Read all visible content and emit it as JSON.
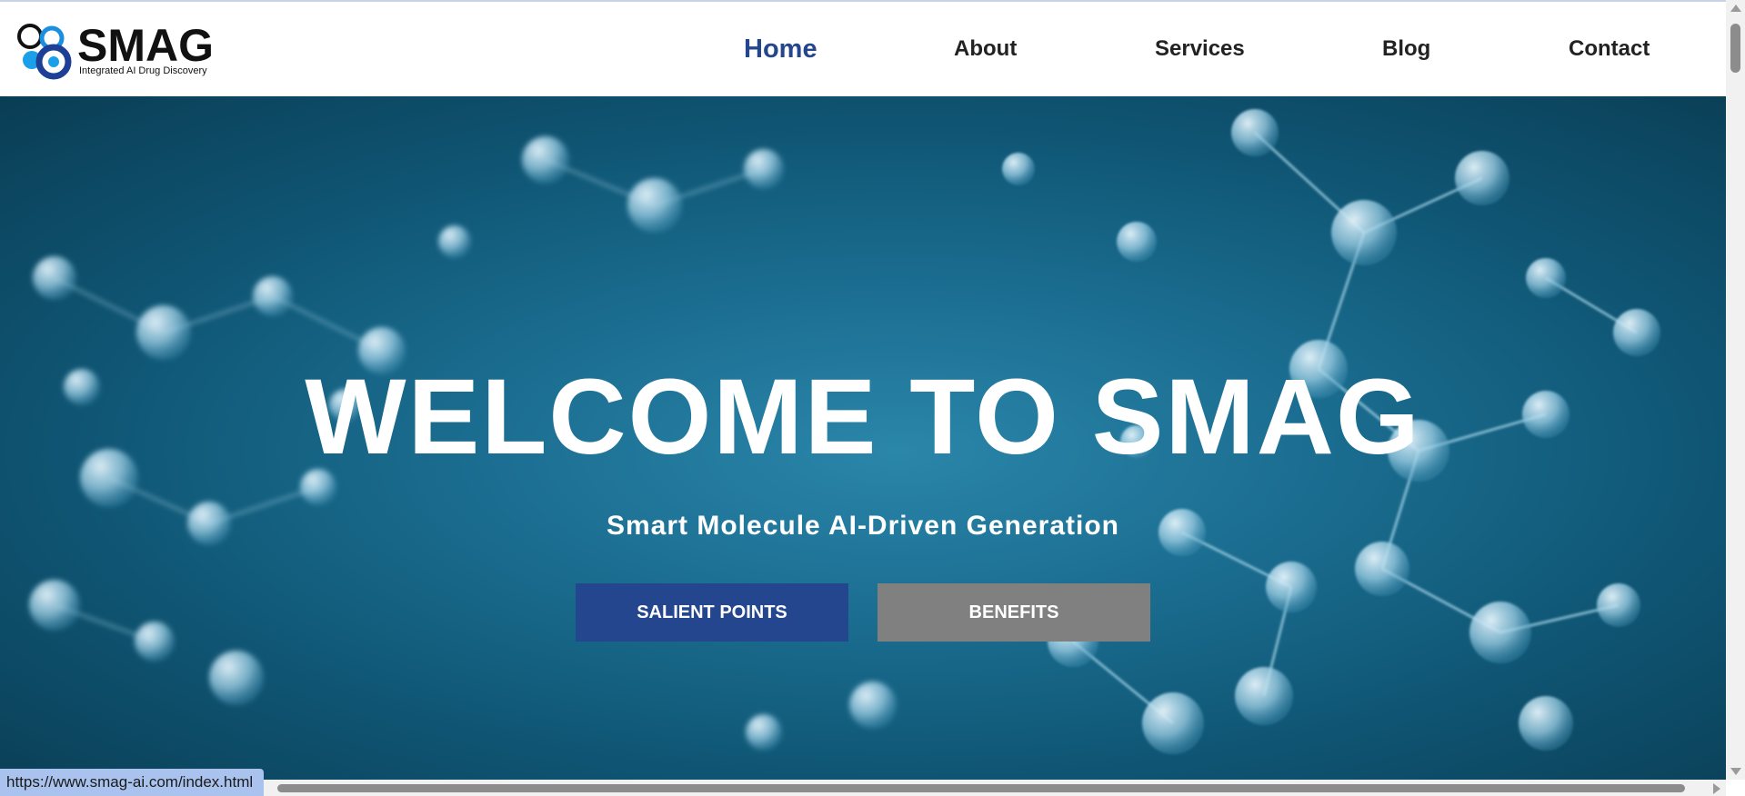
{
  "brand": {
    "name": "SMAG",
    "tagline": "Integrated AI Drug Discovery"
  },
  "nav": {
    "home": "Home",
    "about": "About",
    "services": "Services",
    "blog": "Blog",
    "contact": "Contact",
    "active": "Home"
  },
  "hero": {
    "title": "WELCOME TO SMAG",
    "subtitle": "Smart Molecule AI-Driven Generation",
    "primary_button": "SALIENT POINTS",
    "secondary_button": "BENEFITS",
    "background": "molecule-network-image"
  },
  "status_bar": {
    "url": "https://www.smag-ai.com/index.html"
  },
  "colors": {
    "accent": "#23468f",
    "secondary_button": "#808080",
    "hero_bg": "#1a6c8f"
  }
}
